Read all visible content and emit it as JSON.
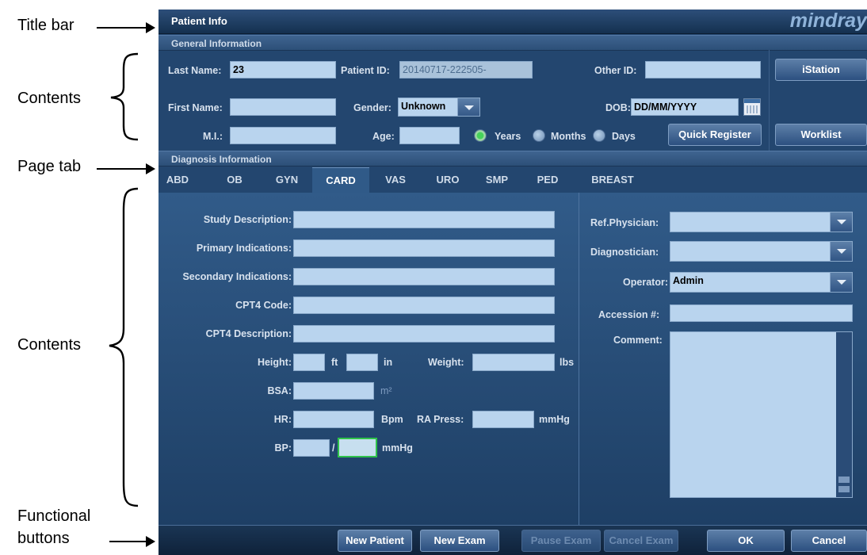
{
  "annotations": {
    "title_bar": "Title bar",
    "contents_top": "Contents",
    "page_tab": "Page tab",
    "contents_main": "Contents",
    "functional_buttons_1": "Functional",
    "functional_buttons_2": "buttons"
  },
  "window": {
    "title": "Patient Info",
    "brand": "mindray"
  },
  "general": {
    "section_title": "General Information",
    "last_name_label": "Last Name:",
    "last_name_value": "23",
    "patient_id_label": "Patient ID:",
    "patient_id_value": "20140717-222505-",
    "other_id_label": "Other ID:",
    "other_id_value": "",
    "first_name_label": "First Name:",
    "first_name_value": "",
    "gender_label": "Gender:",
    "gender_value": "Unknown",
    "dob_label": "DOB:",
    "dob_value": "DD/MM/YYYY",
    "mi_label": "M.I.:",
    "mi_value": "",
    "age_label": "Age:",
    "age_value": "",
    "age_units": [
      "Years",
      "Months",
      "Days"
    ],
    "age_unit_selected": "Years",
    "quick_register": "Quick Register",
    "istation": "iStation",
    "worklist": "Worklist"
  },
  "diagnosis": {
    "section_title": "Diagnosis Information",
    "tabs": [
      "ABD",
      "OB",
      "GYN",
      "CARD",
      "VAS",
      "URO",
      "SMP",
      "PED",
      "BREAST"
    ],
    "active_tab": "CARD"
  },
  "form": {
    "study_description": "Study Description:",
    "primary_indications": "Primary Indications:",
    "secondary_indications": "Secondary Indications:",
    "cpt4_code": "CPT4 Code:",
    "cpt4_description": "CPT4 Description:",
    "height": "Height:",
    "ft": "ft",
    "in": "in",
    "weight": "Weight:",
    "lbs": "lbs",
    "bsa": "BSA:",
    "bsa_unit": "m²",
    "hr": "HR:",
    "bpm": "Bpm",
    "ra_press": "RA Press:",
    "ra_unit": "mmHg",
    "bp": "BP:",
    "bp_sep": "/",
    "bp_unit": "mmHg",
    "ref_physician": "Ref.Physician:",
    "diagnostician": "Diagnostician:",
    "operator": "Operator:",
    "operator_value": "Admin",
    "accession": "Accession #:",
    "comment": "Comment:"
  },
  "buttons": {
    "new_patient": "New Patient",
    "new_exam": "New Exam",
    "pause_exam": "Pause Exam",
    "cancel_exam": "Cancel Exam",
    "ok": "OK",
    "cancel": "Cancel"
  },
  "colors": {
    "panel": "#23466f",
    "field": "#b9d4ee",
    "accent_green": "#2ec24a"
  }
}
